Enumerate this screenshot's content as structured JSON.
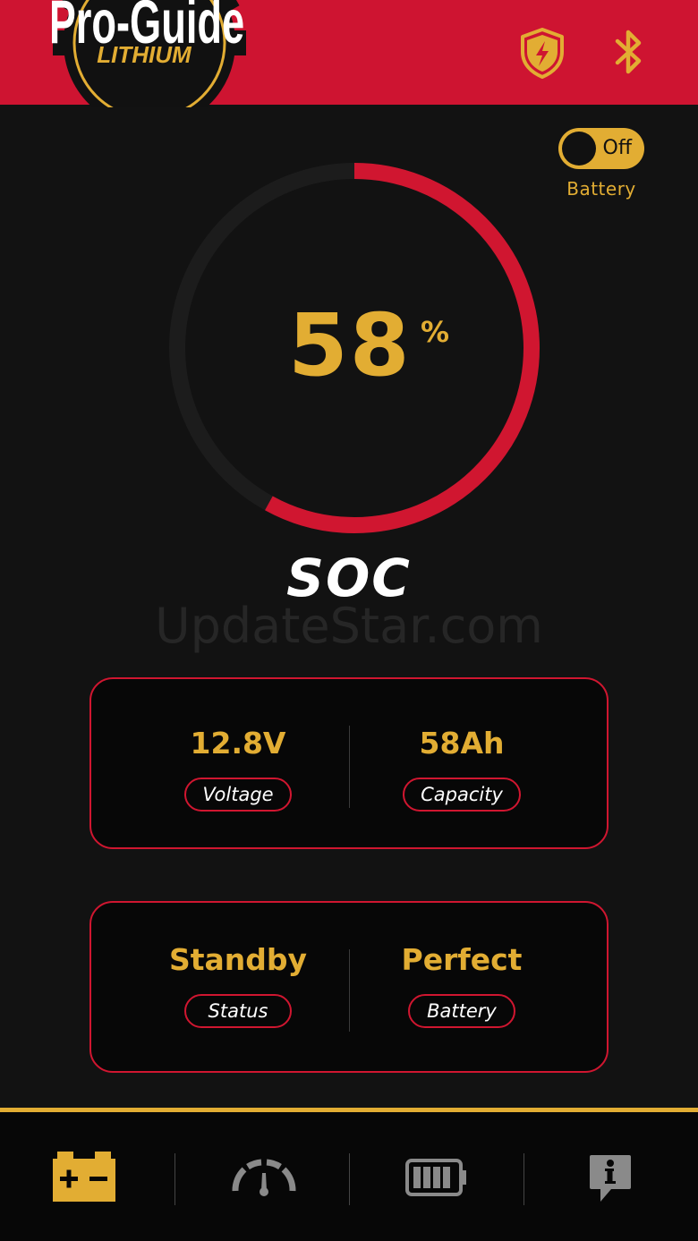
{
  "app": {
    "logo_text_top": "Pro-Guide",
    "logo_text_bottom": "LITHIUM"
  },
  "header": {
    "icons": [
      "shield-bolt-icon",
      "bluetooth-icon"
    ]
  },
  "toggle": {
    "state_text": "Off",
    "label": "Battery",
    "on": false
  },
  "gauge": {
    "value": "58",
    "unit": "%",
    "percent": 58,
    "label": "SOC"
  },
  "watermark": "UpdateStar.com",
  "card_metrics": {
    "voltage": {
      "value": "12.8V",
      "label": "Voltage"
    },
    "capacity": {
      "value": "58Ah",
      "label": "Capacity"
    },
    "status": {
      "value": "Standby",
      "label": "Status"
    },
    "battery": {
      "value": "Perfect",
      "label": "Battery"
    }
  },
  "bottom_nav": {
    "items": [
      "battery-terminal-icon",
      "gauge-meter-icon",
      "battery-level-icon",
      "info-icon"
    ],
    "active": 0
  },
  "colors": {
    "brand_red": "#ce1431",
    "accent_gold": "#e2ad33",
    "background": "#121212"
  }
}
